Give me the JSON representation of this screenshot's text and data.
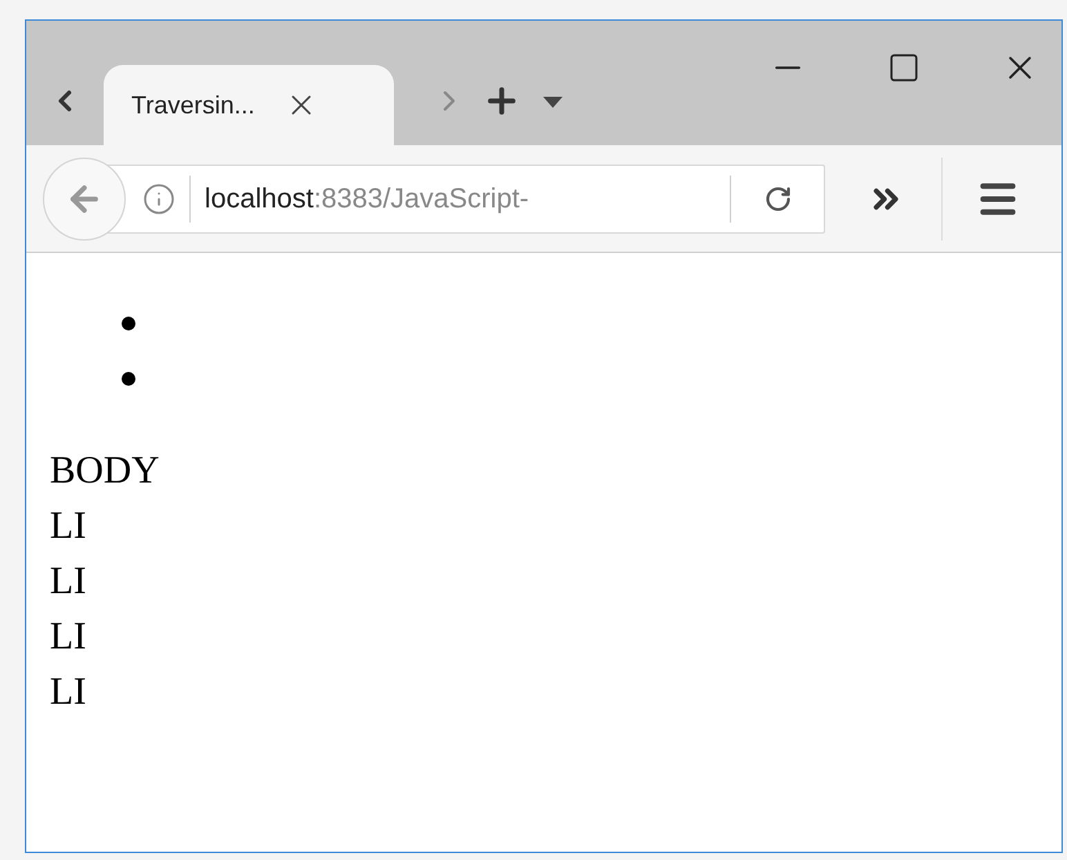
{
  "tab": {
    "title": "Traversin..."
  },
  "address_bar": {
    "host": "localhost",
    "path": ":8383/JavaScript-"
  },
  "page": {
    "list": [
      {
        "kind": "empty"
      },
      {
        "kind": "empty"
      }
    ],
    "output_lines": [
      "BODY",
      "LI",
      "LI",
      "LI",
      "LI"
    ]
  }
}
